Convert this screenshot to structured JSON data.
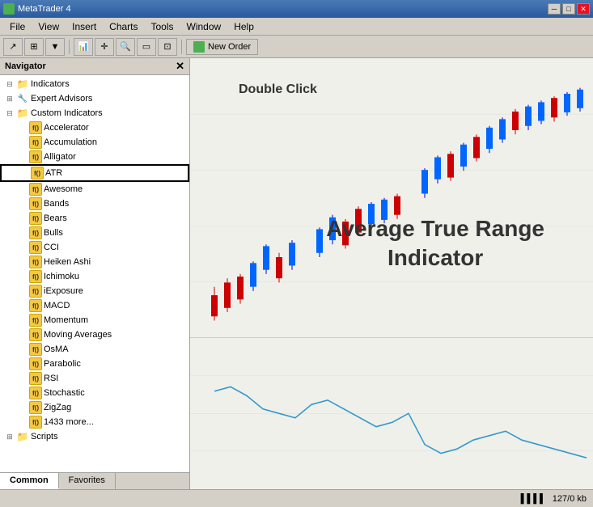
{
  "titleBar": {
    "title": "MetaTrader 4",
    "minimizeLabel": "─",
    "maximizeLabel": "□",
    "closeLabel": "✕"
  },
  "menuBar": {
    "items": [
      "File",
      "View",
      "Insert",
      "Charts",
      "Tools",
      "Window",
      "Help"
    ]
  },
  "toolbar": {
    "newOrderLabel": "New Order"
  },
  "navigator": {
    "title": "Navigator",
    "closeLabel": "✕",
    "tree": {
      "indicators": {
        "label": "Indicators",
        "expanded": true
      },
      "expertAdvisors": {
        "label": "Expert Advisors"
      },
      "customIndicators": {
        "label": "Custom Indicators",
        "expanded": true,
        "items": [
          "Accelerator",
          "Accumulation",
          "Alligator",
          "ATR",
          "Awesome",
          "Bands",
          "Bears",
          "Bulls",
          "CCI",
          "Heiken Ashi",
          "Ichimoku",
          "iExposure",
          "MACD",
          "Momentum",
          "Moving Averages",
          "OsMA",
          "Parabolic",
          "RSI",
          "Stochastic",
          "ZigZag",
          "1433 more..."
        ]
      },
      "scripts": {
        "label": "Scripts"
      }
    },
    "tabs": [
      "Common",
      "Favorites"
    ]
  },
  "chart": {
    "doubleClickLabel": "Double Click",
    "atrLabel": "Average True Range\nIndicator"
  },
  "statusBar": {
    "indicator": "▌▌▌▌",
    "memory": "127/0 kb"
  }
}
